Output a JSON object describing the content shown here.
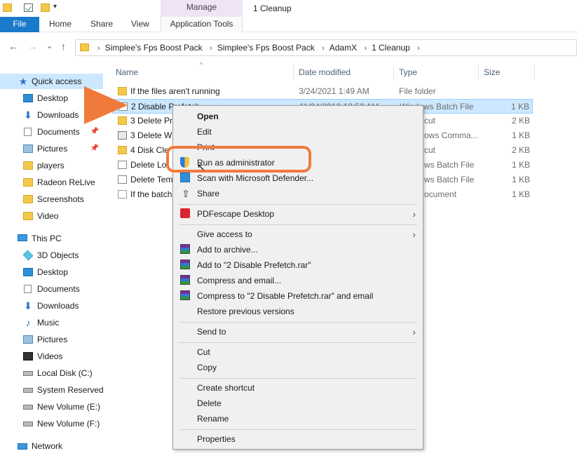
{
  "title_bar": {
    "manage_tab": "Manage",
    "window_title": "1 Cleanup",
    "qat_dropdown": "▾"
  },
  "ribbon": {
    "tabs": [
      "File",
      "Home",
      "Share",
      "View",
      "Application Tools"
    ]
  },
  "nav": {
    "back": "←",
    "forward": "→",
    "recent": "⌄",
    "up": "↑",
    "breadcrumbs": [
      "Simplee's Fps Boost Pack",
      "Simplee's Fps Boost Pack",
      "AdamX",
      "1 Cleanup"
    ]
  },
  "sidebar": {
    "quick_access": "Quick access",
    "quick_items": [
      {
        "label": "Desktop",
        "icon": "desktop-icon",
        "pinned": true
      },
      {
        "label": "Downloads",
        "icon": "downloads-icon",
        "pinned": true
      },
      {
        "label": "Documents",
        "icon": "documents-icon",
        "pinned": true
      },
      {
        "label": "Pictures",
        "icon": "pictures-icon",
        "pinned": true
      },
      {
        "label": "players",
        "icon": "folder-icon",
        "pinned": false
      },
      {
        "label": "Radeon ReLive",
        "icon": "folder-icon",
        "pinned": false
      },
      {
        "label": "Screenshots",
        "icon": "folder-icon",
        "pinned": false
      },
      {
        "label": "Video",
        "icon": "folder-icon",
        "pinned": false
      }
    ],
    "this_pc": "This PC",
    "pc_items": [
      {
        "label": "3D Objects",
        "icon": "3d-objects-icon"
      },
      {
        "label": "Desktop",
        "icon": "desktop-icon"
      },
      {
        "label": "Documents",
        "icon": "documents-icon"
      },
      {
        "label": "Downloads",
        "icon": "downloads-icon"
      },
      {
        "label": "Music",
        "icon": "music-icon"
      },
      {
        "label": "Pictures",
        "icon": "pictures-icon"
      },
      {
        "label": "Videos",
        "icon": "videos-icon"
      },
      {
        "label": "Local Disk (C:)",
        "icon": "disk-icon"
      },
      {
        "label": "System Reserved",
        "icon": "disk-icon"
      },
      {
        "label": "New Volume (E:)",
        "icon": "disk-icon"
      },
      {
        "label": "New Volume (F:)",
        "icon": "disk-icon"
      }
    ],
    "network": "Network"
  },
  "file_list": {
    "headers": {
      "name": "Name",
      "date": "Date modified",
      "type": "Type",
      "size": "Size"
    },
    "rows": [
      {
        "name": "If the files aren't running",
        "date": "3/24/2021 1:49 AM",
        "type": "File folder",
        "size": "",
        "icon": "folder-icon"
      },
      {
        "name": "2 Disable Prefetch",
        "date": "11/24/2019 12:52 AM",
        "type": "Windows Batch File",
        "size": "1 KB",
        "icon": "batch-file-icon"
      },
      {
        "name": "3 Delete Pre",
        "date": "",
        "type": "cut",
        "size": "2 KB",
        "icon": "shortcut-icon"
      },
      {
        "name": "3 Delete Wi",
        "date": "",
        "type": "ows Comma...",
        "size": "1 KB",
        "icon": "cmd-file-icon"
      },
      {
        "name": "4 Disk Cle",
        "date": "",
        "type": "cut",
        "size": "2 KB",
        "icon": "shortcut-icon"
      },
      {
        "name": "Delete Lo",
        "date": "",
        "type": "ws Batch File",
        "size": "1 KB",
        "icon": "batch-file-icon"
      },
      {
        "name": "Delete Temp",
        "date": "",
        "type": "ws Batch File",
        "size": "1 KB",
        "icon": "batch-file-icon"
      },
      {
        "name": "If the batch",
        "date": "",
        "type": "ocument",
        "size": "1 KB",
        "icon": "text-file-icon"
      }
    ]
  },
  "context_menu": {
    "items": [
      {
        "label": "Open",
        "bold": true,
        "icon": ""
      },
      {
        "label": "Edit",
        "icon": ""
      },
      {
        "label": "Print",
        "icon": ""
      },
      {
        "label": "Run as administrator",
        "icon": "shield-icon"
      },
      {
        "label": "Scan with Microsoft Defender...",
        "icon": "defender-icon"
      },
      {
        "label": "Share",
        "icon": "share-icon"
      },
      {
        "label": "PDFescape Desktop",
        "icon": "pdf-icon",
        "submenu": true
      },
      {
        "label": "Give access to",
        "icon": "",
        "submenu": true
      },
      {
        "label": "Add to archive...",
        "icon": "winrar-icon"
      },
      {
        "label": "Add to \"2 Disable Prefetch.rar\"",
        "icon": "winrar-icon"
      },
      {
        "label": "Compress and email...",
        "icon": "winrar-icon"
      },
      {
        "label": "Compress to \"2 Disable Prefetch.rar\" and email",
        "icon": "winrar-icon"
      },
      {
        "label": "Restore previous versions",
        "icon": ""
      },
      {
        "label": "Send to",
        "icon": "",
        "submenu": true
      },
      {
        "label": "Cut",
        "icon": ""
      },
      {
        "label": "Copy",
        "icon": ""
      },
      {
        "label": "Create shortcut",
        "icon": ""
      },
      {
        "label": "Delete",
        "icon": ""
      },
      {
        "label": "Rename",
        "icon": ""
      },
      {
        "label": "Properties",
        "icon": ""
      }
    ],
    "submenu_arrow": "›"
  },
  "colors": {
    "accent": "#1979ca",
    "selection": "#cce8ff",
    "annotation": "#f07a3c",
    "manage_tab": "#efe4f6"
  }
}
